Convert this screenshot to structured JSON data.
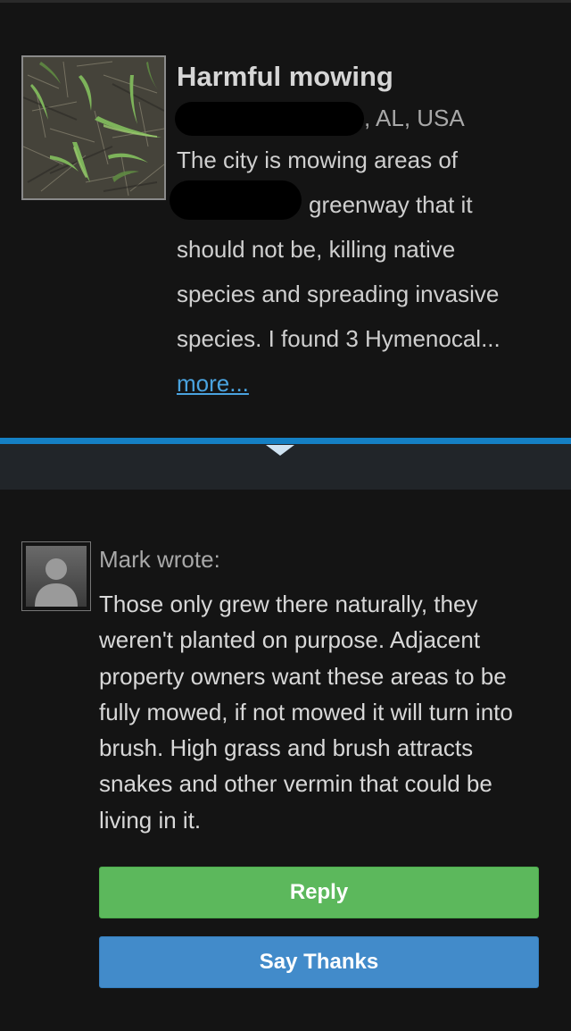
{
  "post": {
    "title": "Harmful mowing",
    "location_suffix": ", AL, USA",
    "description_lines": [
      "The city is mowing areas of",
      "greenway that it",
      "should not be, killing native",
      "species and spreading invasive",
      "species. I found 3 Hymenocal..."
    ],
    "more_label": "more..."
  },
  "reply": {
    "author_line": "Mark wrote:",
    "text": "Those only grew there naturally, they weren't planted on purpose. Adjacent property owners want these areas to be fully mowed, if not mowed it will turn into brush. High grass and brush attracts snakes and other vermin that could be living in it."
  },
  "buttons": {
    "reply_label": "Reply",
    "thanks_label": "Say Thanks"
  },
  "colors": {
    "background": "#141414",
    "accent_blue": "#1580c4",
    "link": "#4aa3df",
    "reply_green": "#5cb85c",
    "thanks_blue": "#428bca"
  },
  "icons": {
    "expand": "chevron-down-icon",
    "avatar": "default-user-avatar-icon"
  }
}
